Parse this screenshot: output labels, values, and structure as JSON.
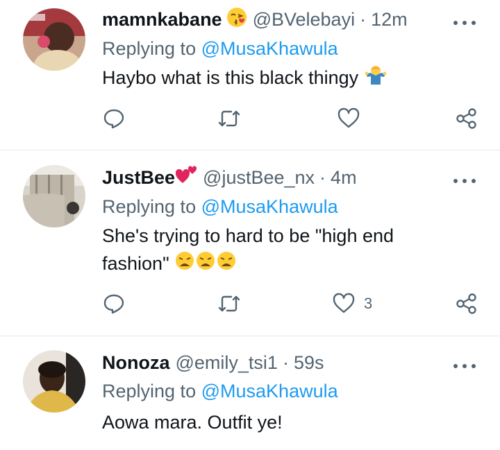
{
  "replies": [
    {
      "name": "mamnkabane",
      "handle": "@BVelebayi",
      "separator": "·",
      "time": "12m",
      "replying_prefix": "Replying to",
      "replying_to": "@MusaKhawula",
      "text": "Haybo what is this black thingy",
      "name_emoji": "kissing-face-emoji",
      "text_emoji": "person-shrugging-emoji",
      "like_count": ""
    },
    {
      "name": "JustBee",
      "handle": "@justBee_nx",
      "separator": "·",
      "time": "4m",
      "replying_prefix": "Replying to",
      "replying_to": "@MusaKhawula",
      "text_line1": "She's trying to hard to be \"high end",
      "text_line2": "fashion\"",
      "name_emoji": "two-hearts-emoji",
      "text_emoji": "weary-face-emoji",
      "like_count": "3"
    },
    {
      "name": "Nonoza",
      "handle": "@emily_tsi1",
      "separator": "·",
      "time": "59s",
      "replying_prefix": "Replying to",
      "replying_to": "@MusaKhawula",
      "text": "Aowa mara. Outfit ye!",
      "like_count": ""
    }
  ],
  "icons": {
    "more": "more-horizontal-icon",
    "reply": "reply-bubble-icon",
    "retweet": "retweet-icon",
    "like": "heart-icon",
    "share": "share-icon"
  },
  "colors": {
    "text": "#0f1419",
    "secondary": "#536471",
    "link": "#1d9bf0",
    "divider": "#e6e9ec"
  }
}
